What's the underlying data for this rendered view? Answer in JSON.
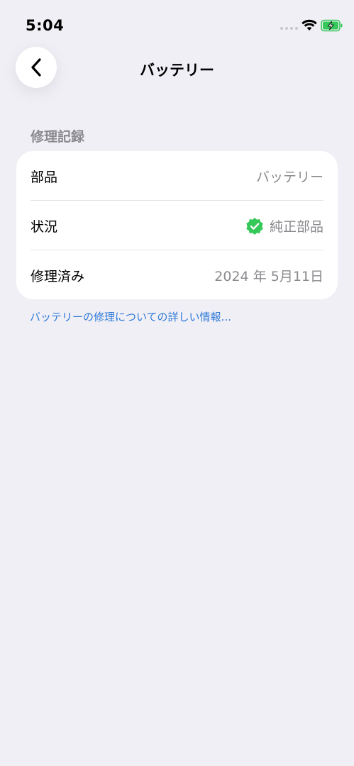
{
  "status_bar": {
    "time": "5:04",
    "icons": [
      "signal-dots-icon",
      "wifi-icon",
      "battery-charging-icon"
    ],
    "battery_color": "#34c759"
  },
  "nav": {
    "back_icon": "chevron-left-icon",
    "title": "バッテリー"
  },
  "section": {
    "header": "修理記録"
  },
  "rows": [
    {
      "label": "部品",
      "value": "バッテリー"
    },
    {
      "label": "状況",
      "value": "純正部品",
      "icon": "verified-badge-icon"
    },
    {
      "label": "修理済み",
      "value": "2024 年 5月11日"
    }
  ],
  "link": {
    "text": "バッテリーの修理についての詳しい情報..."
  },
  "colors": {
    "background": "#f0eff5",
    "card": "#ffffff",
    "secondary_text": "#8a8a8e",
    "link": "#2f7bd9",
    "verified_green": "#34c759"
  }
}
